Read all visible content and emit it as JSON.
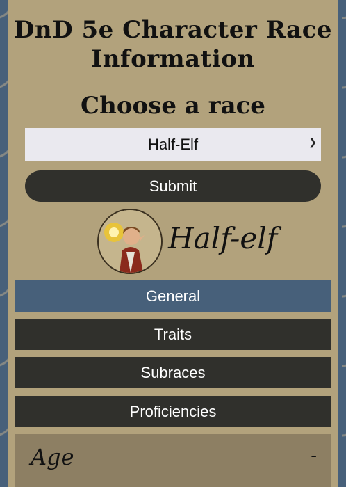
{
  "app": {
    "title": "DnD 5e Character Race Information"
  },
  "selector": {
    "heading": "Choose a race",
    "selected": "Half-Elf",
    "submit_label": "Submit"
  },
  "race": {
    "display_name": "Half-elf",
    "portrait_icon": "half-elf-portrait-icon"
  },
  "tabs": [
    {
      "label": "General",
      "active": true
    },
    {
      "label": "Traits",
      "active": false
    },
    {
      "label": "Subraces",
      "active": false
    },
    {
      "label": "Proficiencies",
      "active": false
    }
  ],
  "sections": [
    {
      "label": "Age",
      "toggle": "-"
    }
  ],
  "colors": {
    "accent": "#47607a",
    "dark": "#30302c",
    "panel": "#b2a27c",
    "section": "#8d7f63"
  }
}
